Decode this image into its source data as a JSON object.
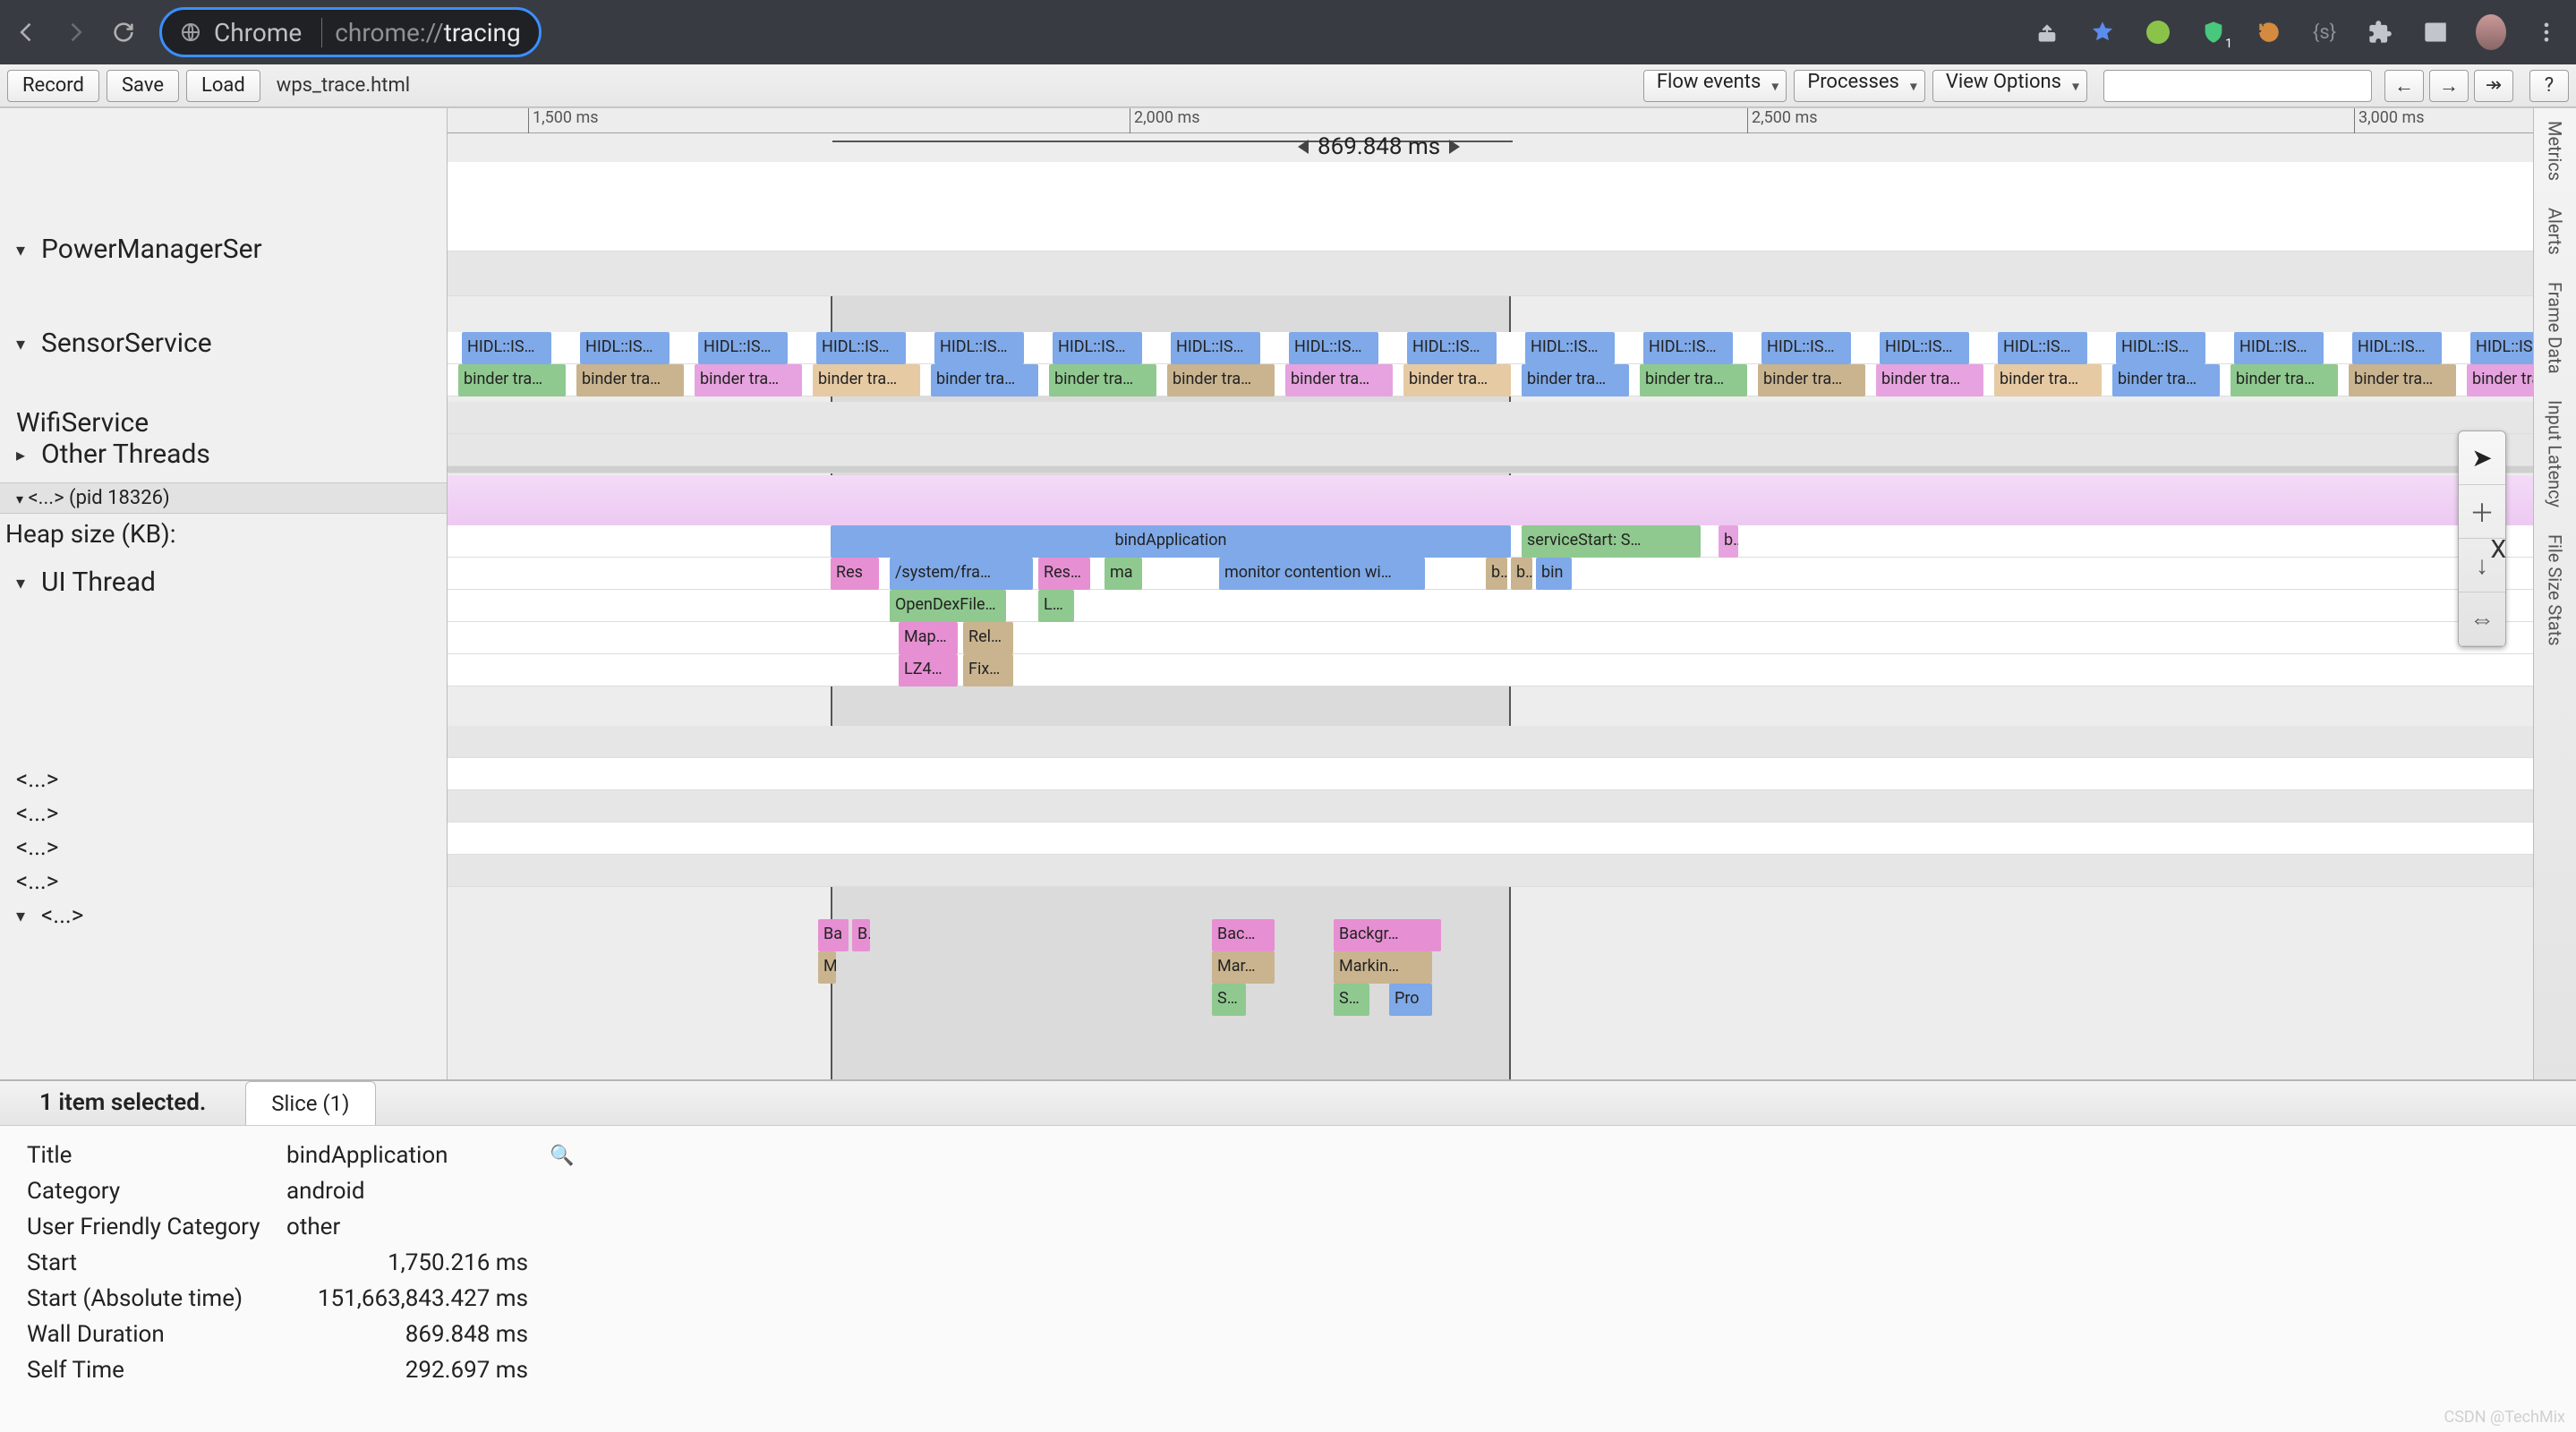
{
  "chrome": {
    "label": "Chrome",
    "url_scheme": "chrome://",
    "url_path": "tracing"
  },
  "toolbar": {
    "record": "Record",
    "save": "Save",
    "load": "Load",
    "filename": "wps_trace.html",
    "flow_events": "Flow events",
    "processes": "Processes",
    "view_options": "View Options",
    "nav_left": "←",
    "nav_right": "→",
    "nav_fast": "↠",
    "help": "?"
  },
  "ruler": {
    "t1500": "1,500 ms",
    "t2000": "2,000 ms",
    "t2500": "2,500 ms",
    "t3000": "3,000 ms",
    "selection_label": "869.848 ms"
  },
  "left": {
    "power": "PowerManagerSer",
    "sensor": "SensorService",
    "wifi": "WifiService",
    "other": "Other Threads",
    "pid": "<...> (pid 18326)",
    "heap": "Heap size (KB):",
    "ui_thread": "UI Thread",
    "dots": "<...>"
  },
  "events": {
    "hidl": "HIDL::IS…",
    "binder": "binder tra…",
    "bindApp": "bindApplication",
    "serviceStart": "serviceStart: S…",
    "res": "Res",
    "system_fra": "/system/fra…",
    "res2": "Res…",
    "ma": "ma",
    "monitor": "monitor contention wi…",
    "bl": "bl",
    "bi": "bi",
    "bin": "bin",
    "opendex": "OpenDexFile…",
    "L": "L…",
    "map": "Map…",
    "rel": "Rel…",
    "lz4": "LZ4…",
    "fix": "Fix…",
    "ba": "Ba",
    "b": "B",
    "m": "M",
    "bac": "Bac…",
    "mar": "Mar…",
    "s": "S…",
    "backgr": "Backgr…",
    "markin": "Markin…",
    "pro": "Pro"
  },
  "side": {
    "metrics": "Metrics",
    "alerts": "Alerts",
    "frame_data": "Frame Data",
    "input_latency": "Input Latency",
    "file_size": "File Size Stats"
  },
  "details": {
    "selected": "1 item selected.",
    "slice_tab": "Slice (1)",
    "rows": {
      "title_k": "Title",
      "title_v": "bindApplication",
      "cat_k": "Category",
      "cat_v": "android",
      "ufc_k": "User Friendly Category",
      "ufc_v": "other",
      "start_k": "Start",
      "start_v": "1,750.216 ms",
      "start_abs_k": "Start (Absolute time)",
      "start_abs_v": "151,663,843.427 ms",
      "wall_k": "Wall Duration",
      "wall_v": "869.848 ms",
      "self_k": "Self Time",
      "self_v": "292.697 ms"
    }
  },
  "close_x": "X",
  "watermark": "CSDN @TechMix"
}
